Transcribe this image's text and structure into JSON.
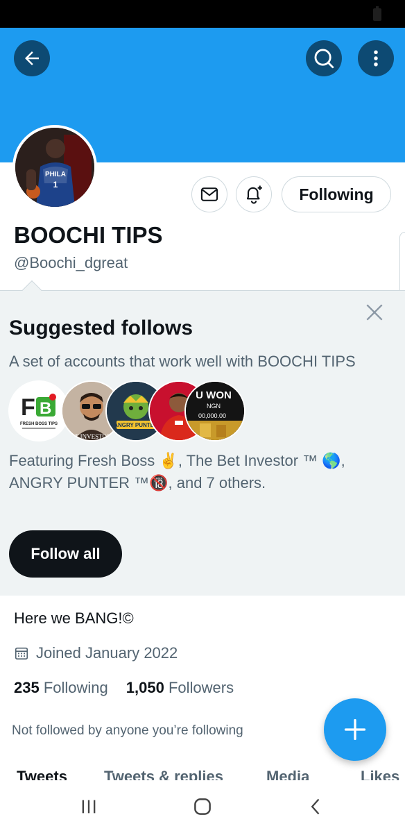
{
  "profile": {
    "display_name": "BOOCHI TIPS",
    "handle": "@Boochi_dgreat",
    "bio": "Here we BANG!©",
    "joined": "Joined January 2022",
    "following_count": "235",
    "following_label": "Following",
    "followers_count": "1,050",
    "followers_label": "Followers",
    "not_followed_text": "Not followed by anyone you’re following",
    "avatar_jersey_text": "PHILA"
  },
  "actions": {
    "following_button_label": "Following"
  },
  "suggested": {
    "title": "Suggested follows",
    "subtitle": "A set of accounts that work well with BOOCHI TIPS",
    "featuring_text": "Featuring Fresh Boss ✌️, The Bet Investor ™ 🌎, ANGRY PUNTER ™🔞, and 7 others.",
    "follow_all_label": "Follow all",
    "avatars": {
      "fresh_boss": "FRESH BOSS TIPS",
      "bet_investor": "T INVESTOR",
      "angry_punter": "ANGRY PUNTER",
      "won_line1": "U WON",
      "won_line2": "NGN",
      "won_line3": "00,000.00"
    }
  },
  "tabs": [
    {
      "label": "Tweets"
    },
    {
      "label": "Tweets & replies"
    },
    {
      "label": "Media"
    },
    {
      "label": "Likes"
    }
  ],
  "colors": {
    "brand_blue": "#1d9bf0",
    "banner_button": "#0d4a73",
    "suggest_bg": "#eff3f4",
    "text_primary": "#0f1419",
    "text_secondary": "#536471"
  },
  "icons": [
    "back-arrow-icon",
    "search-icon",
    "more-vertical-icon",
    "mail-icon",
    "bell-plus-icon",
    "close-icon",
    "calendar-icon",
    "plus-icon",
    "recents-icon",
    "home-icon",
    "back-chevron-icon"
  ]
}
